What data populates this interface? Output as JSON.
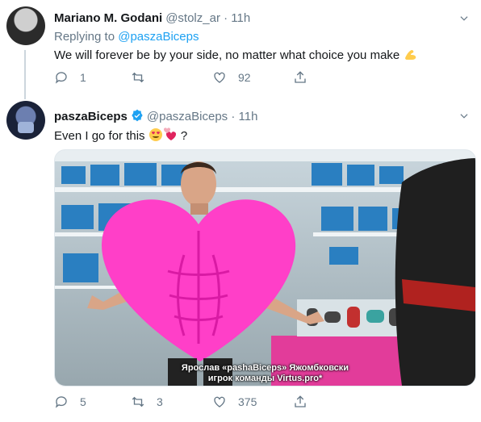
{
  "tweets": [
    {
      "name": "Mariano M. Godani",
      "handle": "@stolz_ar",
      "time": "11h",
      "replying_prefix": "Replying to",
      "replying_to": "@paszaBiceps",
      "text": "We will forever be by your side, no matter what choice you make",
      "emoji": "flexed-biceps",
      "counts": {
        "replies": "1",
        "retweets": "",
        "likes": "92"
      }
    },
    {
      "name": "paszaBiceps",
      "handle": "@paszaBiceps",
      "time": "11h",
      "verified": true,
      "text": "Even I go for this",
      "text_suffix": "?",
      "emoji": [
        "smiling-face-with-heart-eyes",
        "two-hearts"
      ],
      "media_caption": [
        "Ярослав «pashaBiceps» Яжомбковски",
        "игрок команды Virtus.pro*"
      ],
      "counts": {
        "replies": "5",
        "retweets": "3",
        "likes": "375"
      }
    }
  ],
  "colors": {
    "link": "#1da1f2",
    "muted": "#657786",
    "heart_costume": "#ff3fc8",
    "verified": "#1da1f2"
  }
}
